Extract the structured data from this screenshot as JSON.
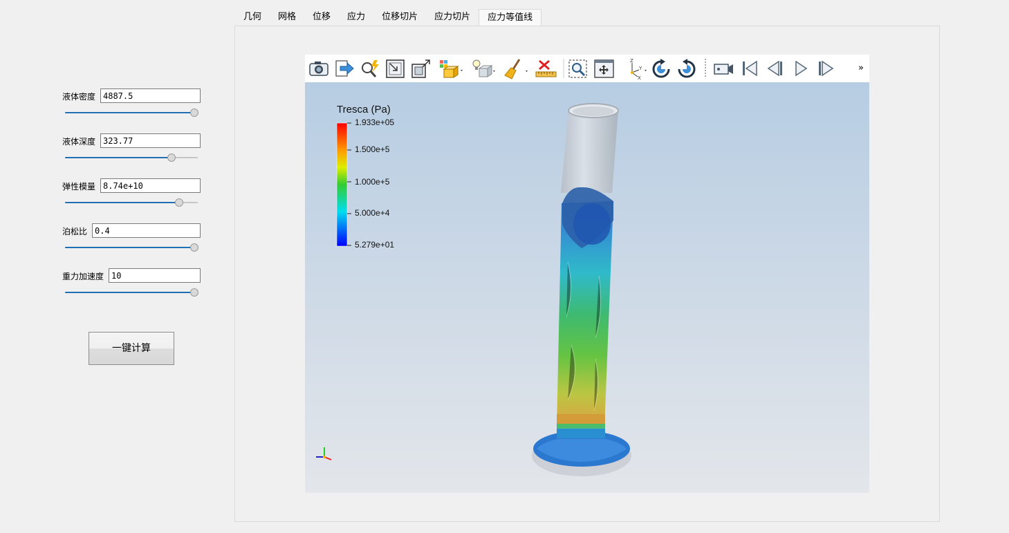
{
  "tabs": [
    "几何",
    "网格",
    "位移",
    "应力",
    "位移切片",
    "应力切片",
    "应力等值线"
  ],
  "active_tab": 6,
  "params": [
    {
      "label": "液体密度",
      "value": "4887.5",
      "slider": 1.0
    },
    {
      "label": "液体深度",
      "value": "323.77",
      "slider": 0.82
    },
    {
      "label": "弹性模量",
      "value": "8.74e+10",
      "slider": 0.88
    },
    {
      "label": "泊松比",
      "value": "0.4",
      "slider": 1.0
    },
    {
      "label": "重力加速度",
      "value": "10",
      "slider": 1.0
    }
  ],
  "calc_button": "一键计算",
  "toolbar": {
    "icons": [
      "camera-icon",
      "export-icon",
      "query-icon",
      "reset-camera-icon",
      "zoom-to-data-icon",
      "representation-icon",
      "lighting-icon",
      "clear-icon",
      "ruler-icon",
      "zoom-to-box-icon",
      "pan-icon",
      "axes-orientation-icon",
      "rotate-cw-icon",
      "rotate-ccw-icon",
      "camera-record-icon",
      "first-frame-icon",
      "previous-frame-icon",
      "play-icon",
      "next-frame-icon"
    ],
    "more": "»"
  },
  "legend": {
    "title": "Tresca (Pa)",
    "ticks": [
      "1.933e+05",
      "1.500e+5",
      "1.000e+5",
      "5.000e+4",
      "5.279e+01"
    ]
  },
  "colors": {
    "accent": "#1f6fb2",
    "colormap": [
      "#ff0000",
      "#ffcc00",
      "#33cc33",
      "#00ddee",
      "#0000ff"
    ]
  }
}
